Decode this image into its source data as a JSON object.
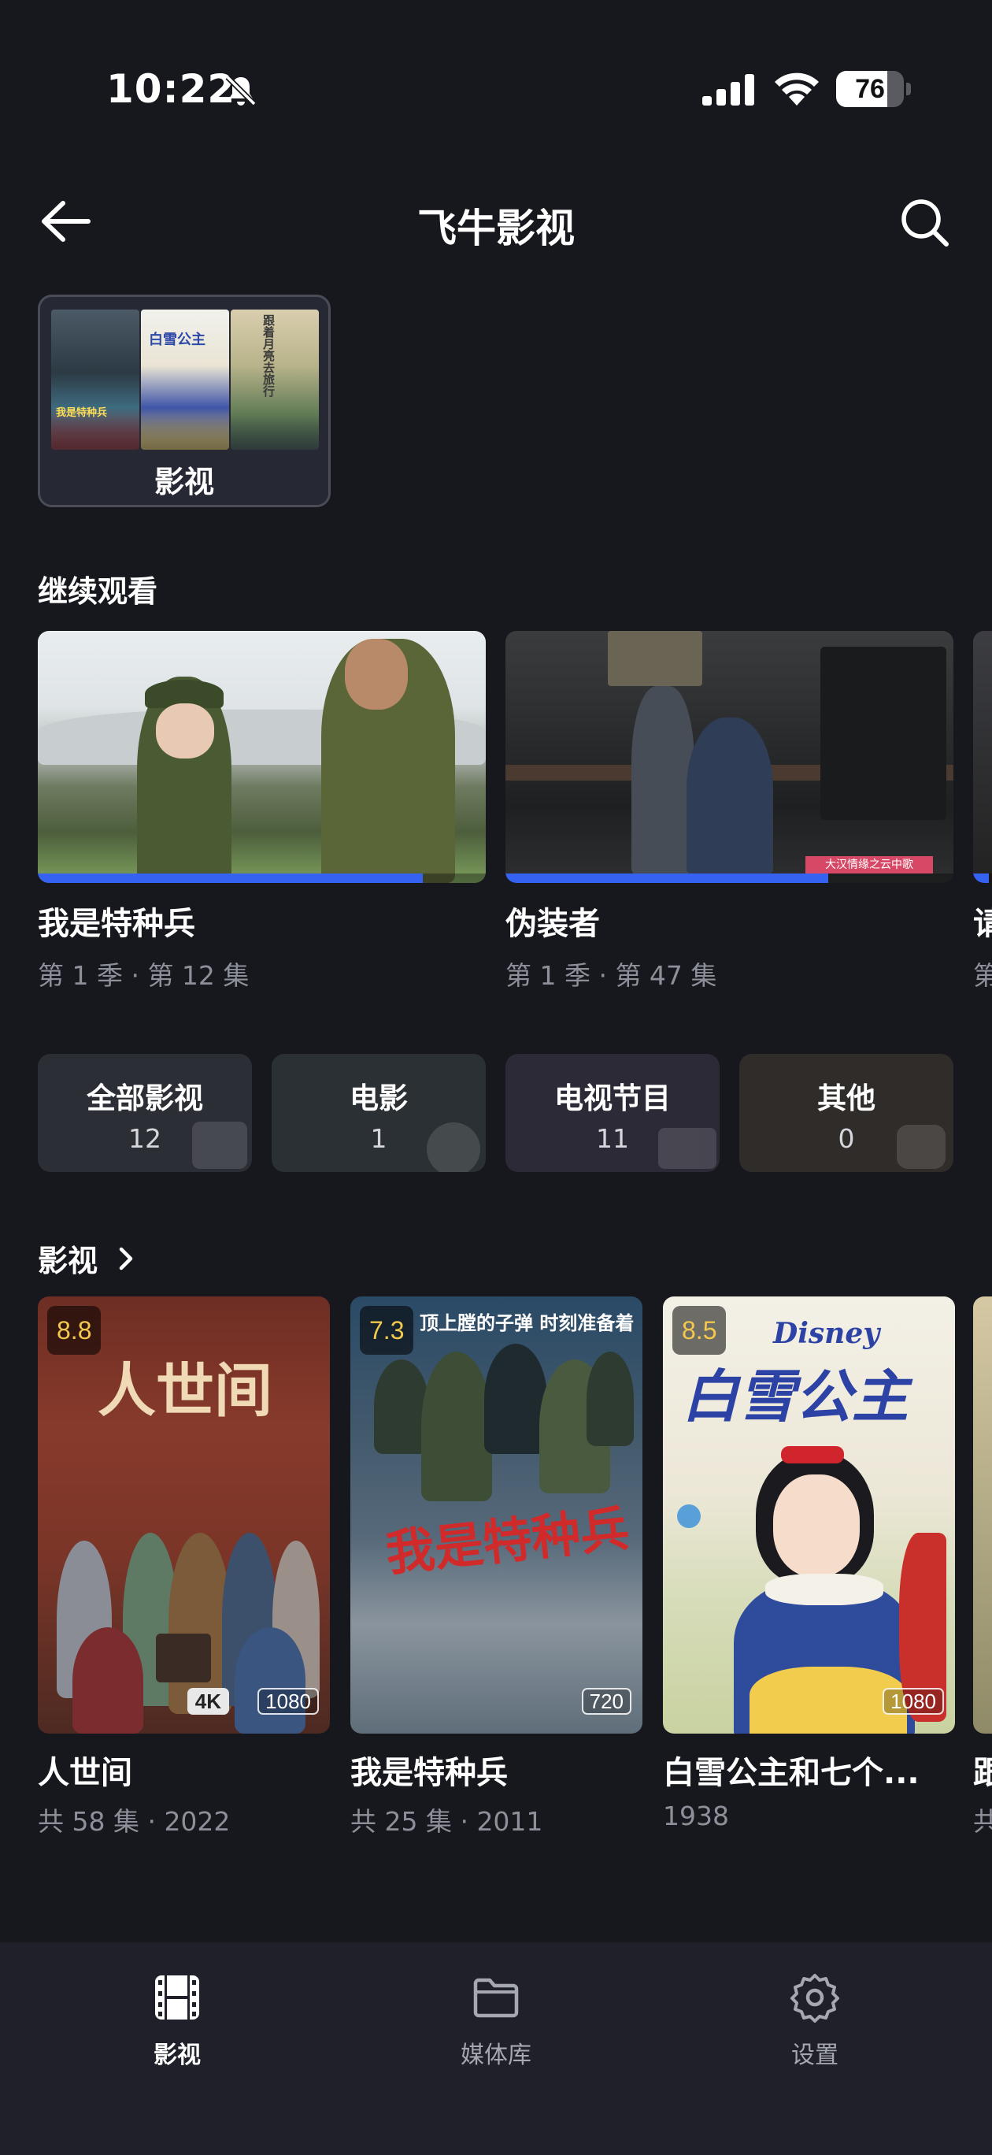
{
  "status_bar": {
    "time": "10:22",
    "battery": "76",
    "battery_level": 0.76
  },
  "header": {
    "title": "飞牛影视"
  },
  "library": {
    "label": "影视",
    "poster_texts": [
      "我是特种兵",
      "白雪公主",
      "跟着月亮去旅行"
    ]
  },
  "continue_watching": {
    "title": "继续观看",
    "items": [
      {
        "title": "我是特种兵",
        "subtitle": "第 1 季 · 第 12 集",
        "progress": 0.86
      },
      {
        "title": "伪装者",
        "subtitle": "第 1 季 · 第 47 集",
        "progress": 0.72,
        "caption": "大汉情缘之云中歌"
      },
      {
        "title": "请",
        "subtitle": "第",
        "progress": 0.5
      }
    ]
  },
  "categories": [
    {
      "label": "全部影视",
      "count": "12",
      "color": "#2c2e36"
    },
    {
      "label": "电影",
      "count": "1",
      "color": "#2a3033"
    },
    {
      "label": "电视节目",
      "count": "11",
      "color": "#2c2a36"
    },
    {
      "label": "其他",
      "count": "0",
      "color": "#302c2a"
    }
  ],
  "media_section": {
    "title": "影视",
    "items": [
      {
        "title": "人世间",
        "subtitle": "共 58 集 · 2022",
        "rating": "8.8",
        "badges": [
          "4K",
          "1080"
        ],
        "poster_text": "人世间"
      },
      {
        "title": "我是特种兵",
        "subtitle": "共 25 集 · 2011",
        "rating": "7.3",
        "badges": [
          "720"
        ],
        "poster_text": "我是特种兵",
        "poster_tagline": "顶上膛的子弹 时刻准备着"
      },
      {
        "title": "白雪公主和七个...",
        "subtitle": "1938",
        "rating": "8.5",
        "badges": [
          "1080"
        ],
        "poster_text": "白雪公主",
        "poster_brand": "Disney"
      },
      {
        "title": "跟",
        "subtitle": "共"
      }
    ]
  },
  "bottom_nav": {
    "items": [
      {
        "label": "影视",
        "icon": "film-icon",
        "active": true
      },
      {
        "label": "媒体库",
        "icon": "folder-icon",
        "active": false
      },
      {
        "label": "设置",
        "icon": "gear-icon",
        "active": false
      }
    ]
  },
  "colors": {
    "background": "#17181e",
    "accent": "#3562f0",
    "rating": "#f2c94c",
    "muted_text": "#8d909a",
    "nav_background": "#1f2029"
  }
}
